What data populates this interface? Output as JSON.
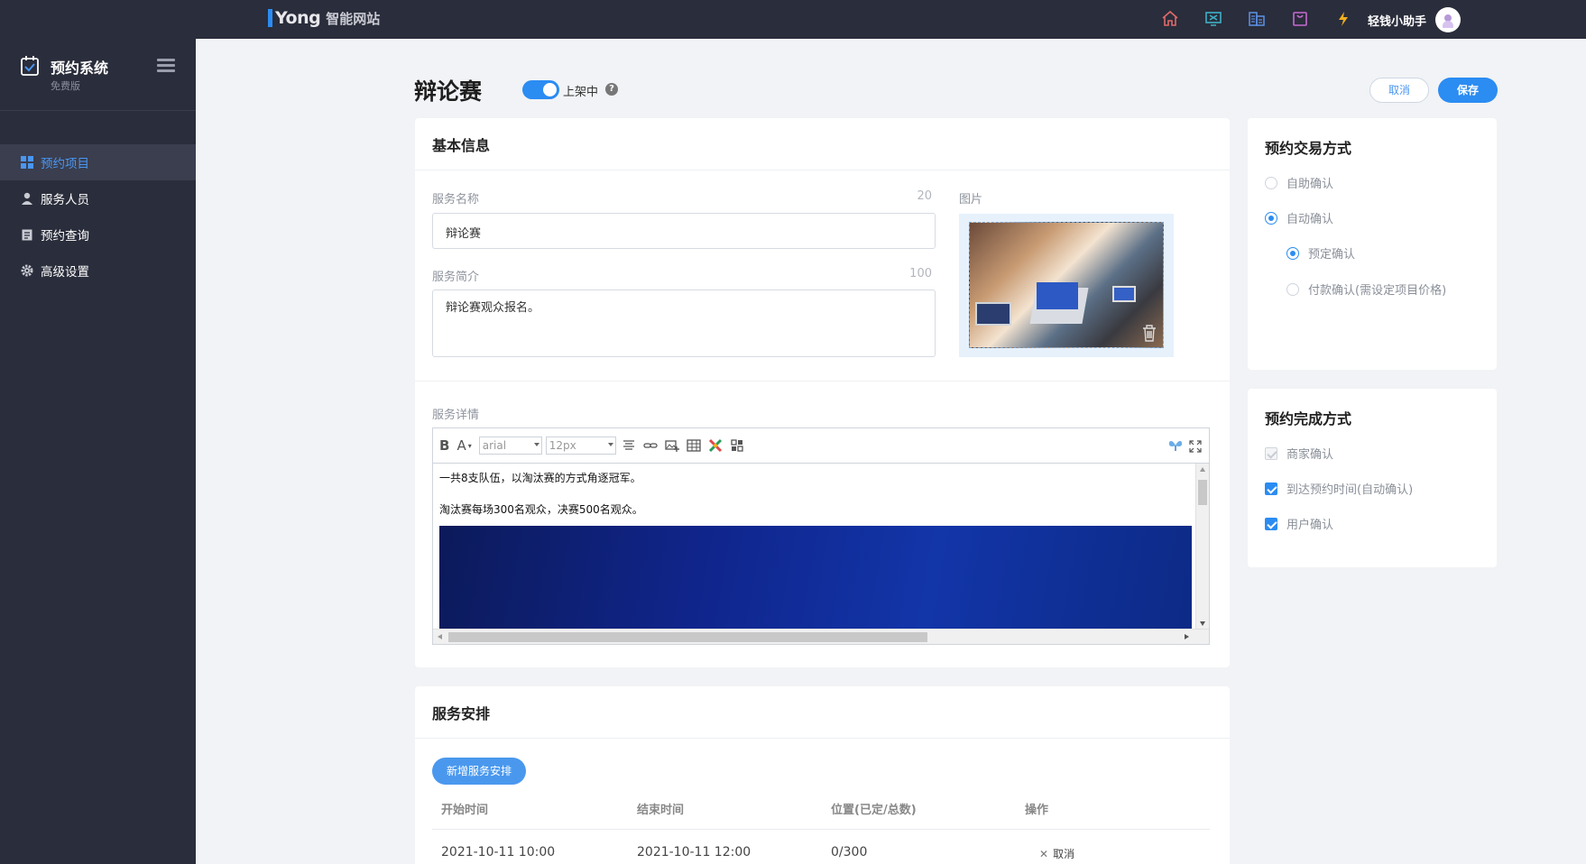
{
  "topbar": {
    "brand_i": "i",
    "brand_yong": "Yong",
    "brand_sub": "智能网站",
    "user_name": "轻钱小助手",
    "icons": [
      "home-icon",
      "monitor-icon",
      "building-icon",
      "bag-icon",
      "lightning-icon"
    ]
  },
  "sidebar": {
    "title": "预约系统",
    "subtitle": "免费版",
    "items": [
      {
        "label": "预约项目",
        "icon": "grid-icon",
        "active": true
      },
      {
        "label": "服务人员",
        "icon": "person-icon",
        "active": false
      },
      {
        "label": "预约查询",
        "icon": "clipboard-icon",
        "active": false
      },
      {
        "label": "高级设置",
        "icon": "gear-icon",
        "active": false
      }
    ]
  },
  "header": {
    "title": "辩论赛",
    "status_label": "上架中",
    "help": "?",
    "cancel_label": "取消",
    "save_label": "保存"
  },
  "basic": {
    "section_title": "基本信息",
    "name_label": "服务名称",
    "name_limit": "20",
    "name_value": "辩论赛",
    "intro_label": "服务简介",
    "intro_limit": "100",
    "intro_value": "辩论赛观众报名。",
    "image_label": "图片",
    "detail_label": "服务详情"
  },
  "editor": {
    "bold": "B",
    "font_color": "A",
    "font_family": "arial",
    "font_size": "12px",
    "paragraphs": [
      "一共8支队伍，以淘汰赛的方式角逐冠军。",
      "淘汰赛每场300名观众，决赛500名观众。"
    ]
  },
  "schedule": {
    "section_title": "服务安排",
    "add_label": "新增服务安排",
    "columns": [
      "开始时间",
      "结束时间",
      "位置(已定/总数)",
      "操作"
    ],
    "rows": [
      {
        "start": "2021-10-11 10:00",
        "end": "2021-10-11 12:00",
        "seats": "0/300",
        "action": "取消"
      }
    ]
  },
  "trade": {
    "title": "预约交易方式",
    "options": [
      {
        "label": "自助确认",
        "selected": false
      },
      {
        "label": "自动确认",
        "selected": true
      },
      {
        "label": "预定确认",
        "selected": true
      },
      {
        "label": "付款确认(需设定项目价格)",
        "selected": false
      }
    ]
  },
  "complete": {
    "title": "预约完成方式",
    "options": [
      {
        "label": "商家确认",
        "checked": false
      },
      {
        "label": "到达预约时间(自动确认)",
        "checked": true
      },
      {
        "label": "用户确认",
        "checked": true
      }
    ]
  },
  "colors": {
    "accent": "#2b8cf2",
    "sidebar_bg": "#2a2d3b",
    "page_bg": "#f1f3f6"
  }
}
